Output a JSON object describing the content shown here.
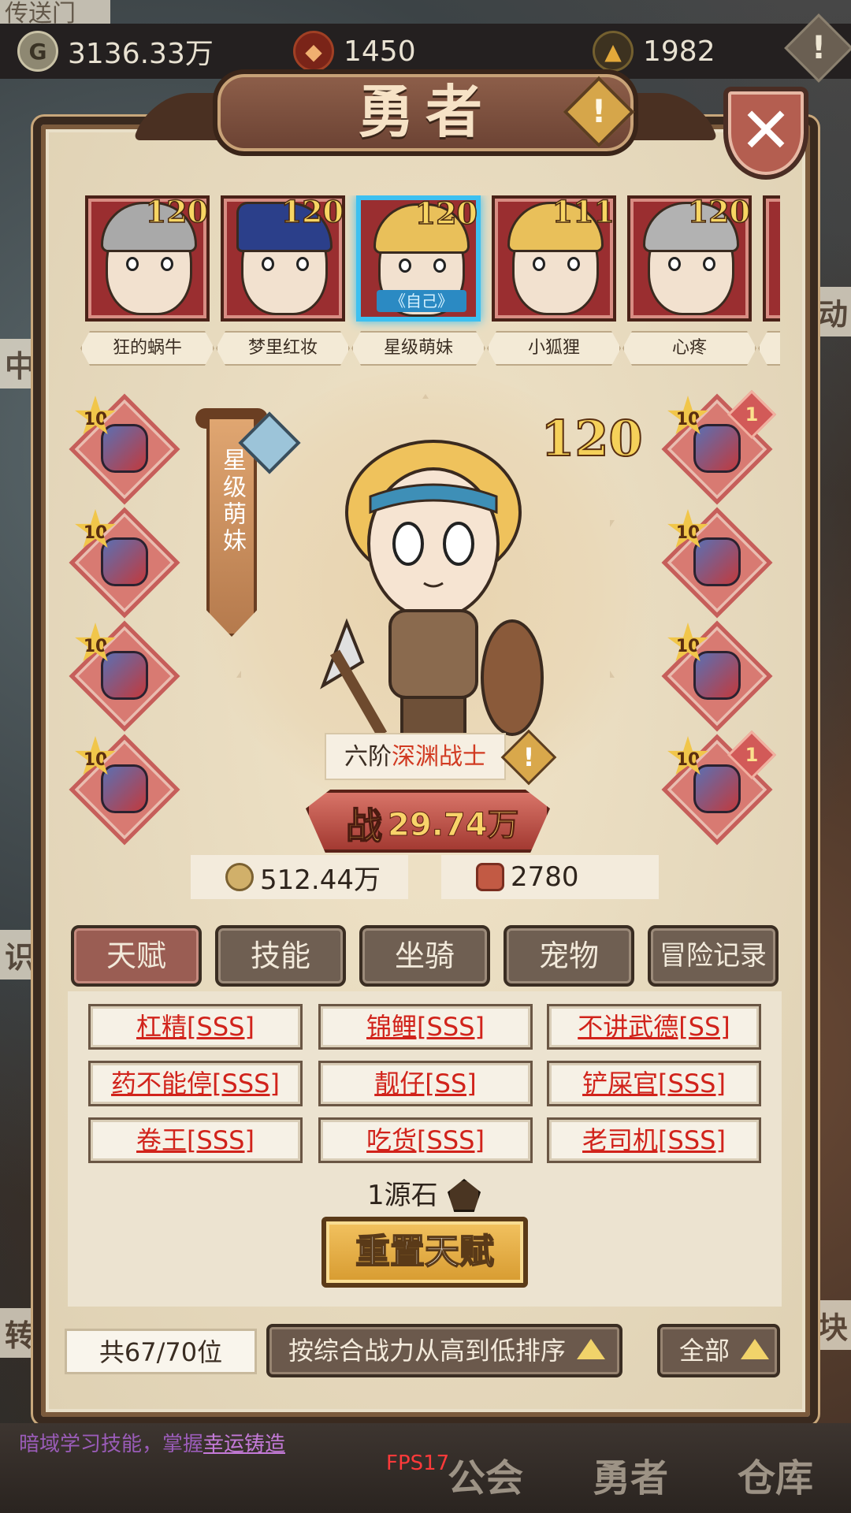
{
  "background": {
    "top_strip": "传送门",
    "left_labels": [
      "中",
      "识",
      "转"
    ],
    "right_labels": [
      "动",
      "块"
    ]
  },
  "resources": [
    {
      "icon": "gold-coin-icon",
      "value": "3136.33万"
    },
    {
      "icon": "red-gem-icon",
      "value": "1450"
    },
    {
      "icon": "ore-icon",
      "value": "1982"
    }
  ],
  "title": "勇者",
  "heroes": [
    {
      "name": "狂的蜗牛",
      "level": "120",
      "self_tag": "",
      "selected": false
    },
    {
      "name": "梦里红妆",
      "level": "120",
      "self_tag": "",
      "selected": false
    },
    {
      "name": "星级萌妹",
      "level": "120",
      "self_tag": "《自己》",
      "selected": true
    },
    {
      "name": "小狐狸",
      "level": "111",
      "self_tag": "",
      "selected": false
    },
    {
      "name": "心疼",
      "level": "120",
      "self_tag": "",
      "selected": false
    }
  ],
  "selected_hero": {
    "banner_name": "星级萌妹",
    "level": "120",
    "class_prefix": "六阶",
    "class_name": "深渊战士",
    "power_label": "战",
    "power": "29.74万",
    "gold": "512.44万",
    "gem": "2780"
  },
  "equipment_left": [
    {
      "slot": "weapon",
      "stars": "10",
      "badge": ""
    },
    {
      "slot": "armor",
      "stars": "10",
      "badge": ""
    },
    {
      "slot": "helmet",
      "stars": "10",
      "badge": ""
    },
    {
      "slot": "boots",
      "stars": "10",
      "badge": ""
    }
  ],
  "equipment_right": [
    {
      "slot": "necklace",
      "stars": "10",
      "badge": "1"
    },
    {
      "slot": "ring",
      "stars": "10",
      "badge": ""
    },
    {
      "slot": "charm",
      "stars": "10",
      "badge": ""
    },
    {
      "slot": "amulet",
      "stars": "10",
      "badge": "1"
    }
  ],
  "tabs": [
    "天赋",
    "技能",
    "坐骑",
    "宠物",
    "冒险记录"
  ],
  "active_tab": "天赋",
  "talents": [
    "杠精[SSS]",
    "锦鲤[SSS]",
    "不讲武德[SS]",
    "药不能停[SSS]",
    "靓仔[SS]",
    "铲屎官[SSS]",
    "卷王[SSS]",
    "吃货[SSS]",
    "老司机[SSS]"
  ],
  "reset": {
    "cost": "1源石",
    "button": "重置天赋"
  },
  "bottom": {
    "count": "共67/70位",
    "sort_label": "按综合战力从高到低排序",
    "filter_label": "全部"
  },
  "footer": {
    "tip_prefix": "暗域学习技能，掌握",
    "tip_link": "幸运铸造",
    "fps": "FPS17",
    "nav": [
      "公会",
      "勇者",
      "仓库"
    ]
  },
  "colors": {
    "panel": "#e9dfc8",
    "tab_active": "#9a5d53",
    "talent_text": "#d1231b",
    "selected_frame": "#3dc0f0",
    "accent_gold": "#f5d15a"
  }
}
